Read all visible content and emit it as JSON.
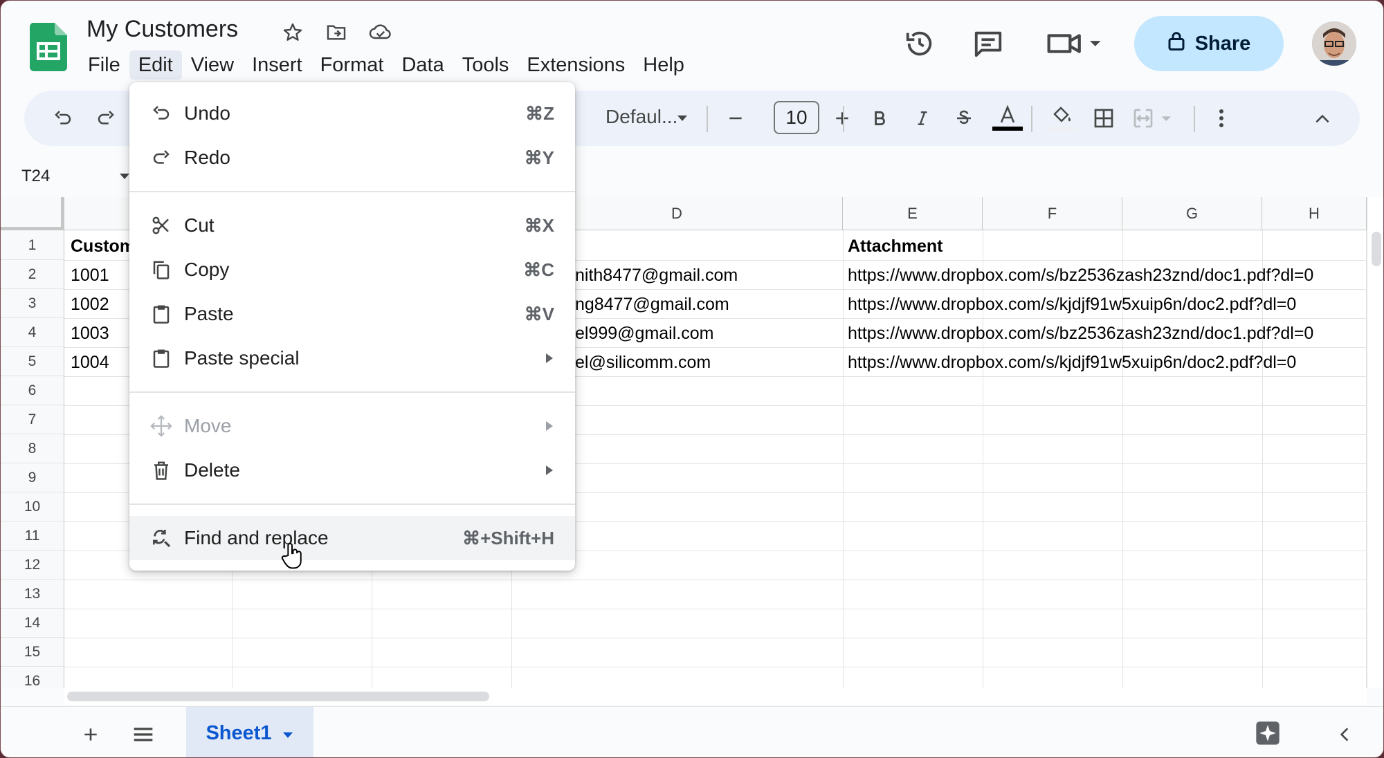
{
  "app": {
    "doc_title": "My Customers",
    "menus": [
      "File",
      "Edit",
      "View",
      "Insert",
      "Format",
      "Data",
      "Tools",
      "Extensions",
      "Help"
    ],
    "active_menu": "Edit",
    "share_label": "Share"
  },
  "toolbar": {
    "font_name": "Defaul...",
    "font_size": "10"
  },
  "formula_bar": {
    "name_box": "T24"
  },
  "grid": {
    "column_headers": [
      "D",
      "E",
      "F",
      "G",
      "H"
    ],
    "row_numbers": [
      "1",
      "2",
      "3",
      "4",
      "5",
      "6",
      "7",
      "8",
      "9",
      "10",
      "11",
      "12",
      "13",
      "14",
      "15",
      "16"
    ],
    "cells": {
      "a1": "Custom",
      "a2": "1001",
      "a3": "1002",
      "a4": "1003",
      "a5": "1004",
      "d2": "nith8477@gmail.com",
      "d3": "ng8477@gmail.com",
      "d4": "el999@gmail.com",
      "d5": "el@silicomm.com",
      "e1": "Attachment",
      "e2": "https://www.dropbox.com/s/bz2536zash23znd/doc1.pdf?dl=0",
      "e3": "https://www.dropbox.com/s/kjdjf91w5xuip6n/doc2.pdf?dl=0",
      "e4": "https://www.dropbox.com/s/bz2536zash23znd/doc1.pdf?dl=0",
      "e5": "https://www.dropbox.com/s/kjdjf91w5xuip6n/doc2.pdf?dl=0"
    }
  },
  "edit_menu": {
    "items": [
      {
        "label": "Undo",
        "shortcut": "⌘Z",
        "icon": "undo-icon"
      },
      {
        "label": "Redo",
        "shortcut": "⌘Y",
        "icon": "redo-icon"
      },
      {
        "label": "Cut",
        "shortcut": "⌘X",
        "icon": "scissors-icon"
      },
      {
        "label": "Copy",
        "shortcut": "⌘C",
        "icon": "copy-icon"
      },
      {
        "label": "Paste",
        "shortcut": "⌘V",
        "icon": "clipboard-icon"
      },
      {
        "label": "Paste special",
        "shortcut": "",
        "icon": "clipboard-icon"
      },
      {
        "label": "Move",
        "shortcut": "",
        "icon": "move-icon",
        "disabled": true
      },
      {
        "label": "Delete",
        "shortcut": "",
        "icon": "trash-icon"
      },
      {
        "label": "Find and replace",
        "shortcut": "⌘+Shift+H",
        "icon": "find-replace-icon",
        "hovered": true
      }
    ]
  },
  "sheets": {
    "active_tab": "Sheet1"
  },
  "colors": {
    "accent": "#0b57d0",
    "share_bg": "#c2e7ff",
    "sheets_green": "#0f9d58"
  }
}
